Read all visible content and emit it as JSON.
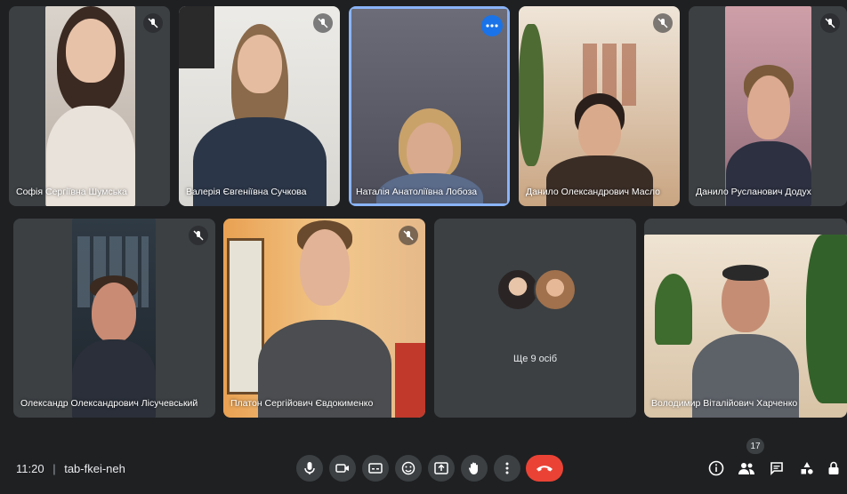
{
  "participants": [
    {
      "name": "Софія Сергіївна Шумська"
    },
    {
      "name": "Валерія Євгеніївна Сучкова"
    },
    {
      "name": "Наталія Анатоліївна Лобоза"
    },
    {
      "name": "Данило Олександрович Масло"
    },
    {
      "name": "Данило Русланович Додух"
    },
    {
      "name": "Олександр Олександрович Лісучевський"
    },
    {
      "name": "Платон Сергійович Євдокименко"
    },
    {
      "name": "Володимир Віталійович Харченко"
    }
  ],
  "others_tile": {
    "label": "Ще 9 осіб"
  },
  "bottom": {
    "time": "11:20",
    "separator": "|",
    "meeting_code": "tab-fkei-neh",
    "people_count": "17"
  },
  "colors": {
    "hangup": "#ea4335",
    "active_speaker": "#8ab4f8",
    "tile": "#3c4043"
  }
}
